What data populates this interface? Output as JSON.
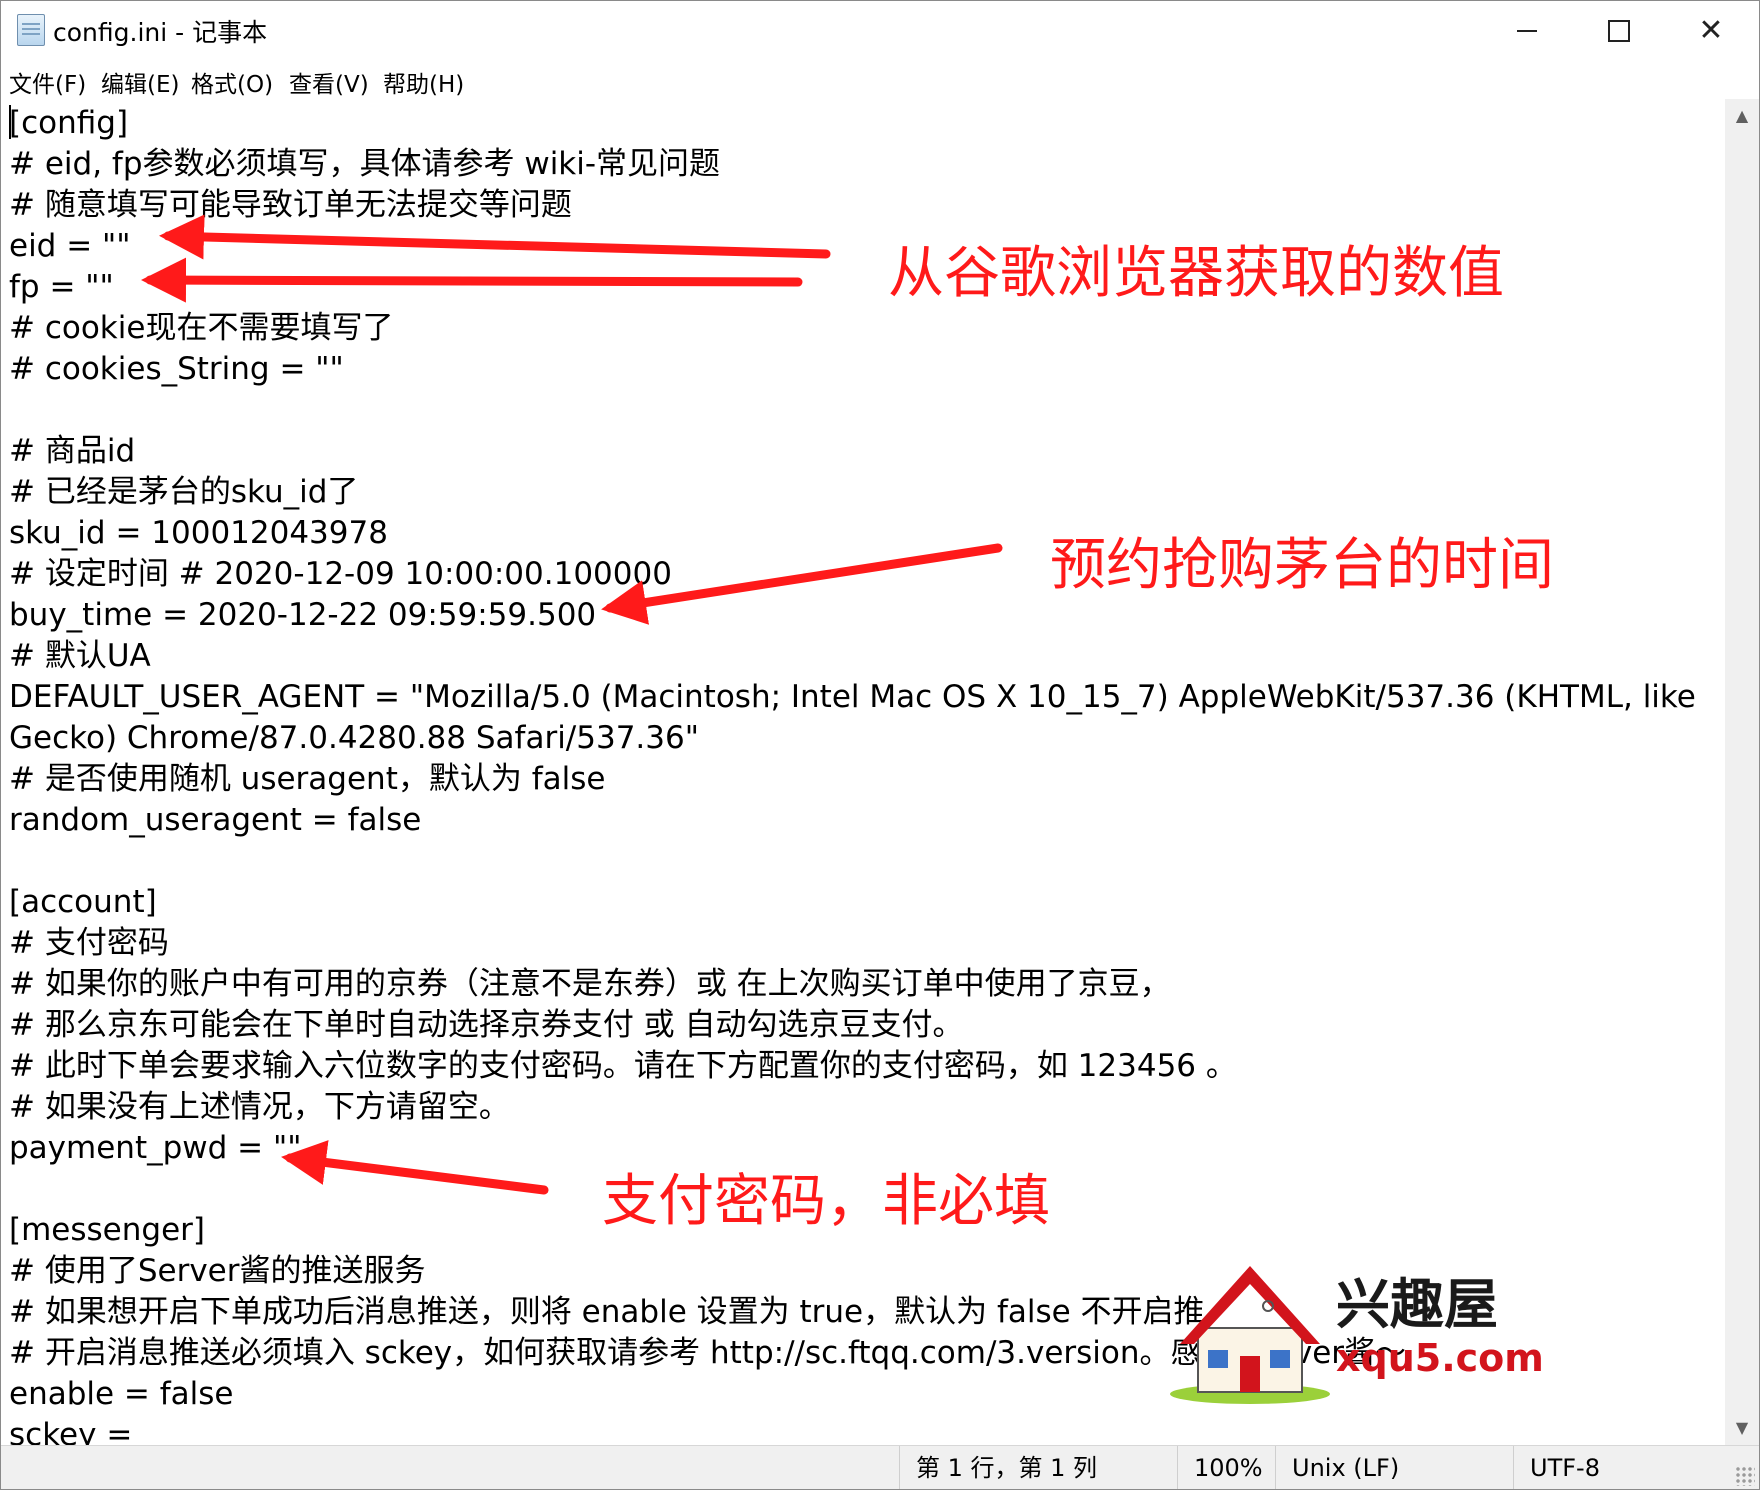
{
  "window": {
    "title": "config.ini - 记事本"
  },
  "menu": [
    "文件(F)",
    "编辑(E)",
    "格式(O)",
    "查看(V)",
    "帮助(H)"
  ],
  "editor": {
    "lines": [
      "[config]",
      "# eid, fp参数必须填写，具体请参考 wiki-常见问题",
      "# 随意填写可能导致订单无法提交等问题",
      "eid = \"\"",
      "fp = \"\"",
      "# cookie现在不需要填写了",
      "# cookies_String = \"\"",
      "",
      "# 商品id",
      "# 已经是茅台的sku_id了",
      "sku_id = 100012043978",
      "# 设定时间 # 2020-12-09 10:00:00.100000",
      "buy_time = 2020-12-22 09:59:59.500",
      "# 默认UA",
      "DEFAULT_USER_AGENT = \"Mozilla/5.0 (Macintosh; Intel Mac OS X 10_15_7) AppleWebKit/537.36 (KHTML, like",
      "Gecko) Chrome/87.0.4280.88 Safari/537.36\"",
      "# 是否使用随机 useragent，默认为 false",
      "random_useragent = false",
      "",
      "[account]",
      "# 支付密码",
      "# 如果你的账户中有可用的京券（注意不是东券）或 在上次购买订单中使用了京豆，",
      "# 那么京东可能会在下单时自动选择京券支付 或 自动勾选京豆支付。",
      "# 此时下单会要求输入六位数字的支付密码。请在下方配置你的支付密码，如 123456 。",
      "# 如果没有上述情况，下方请留空。",
      "payment_pwd = \"\"",
      "",
      "[messenger]",
      "# 使用了Server酱的推送服务",
      "# 如果想开启下单成功后消息推送，则将 enable 设置为 true，默认为 false 不开启推",
      "# 开启消息推送必须填入 sckey，如何获取请参考 http://sc.ftqq.com/3.version。感谢 Server酱～",
      "enable = false",
      "sckey ="
    ]
  },
  "status": {
    "position": "第 1 行，第 1 列",
    "zoom": "100%",
    "line_ending": "Unix (LF)",
    "encoding": "UTF-8"
  },
  "annotations": {
    "eid_fp": "从谷歌浏览器获取的数值",
    "buy_time": "预约抢购茅台的时间",
    "payment_pwd": "支付密码，非必填",
    "color": "#ff1a1a"
  },
  "watermark": {
    "name_cn": "兴趣屋",
    "domain": "xqu5.com"
  }
}
